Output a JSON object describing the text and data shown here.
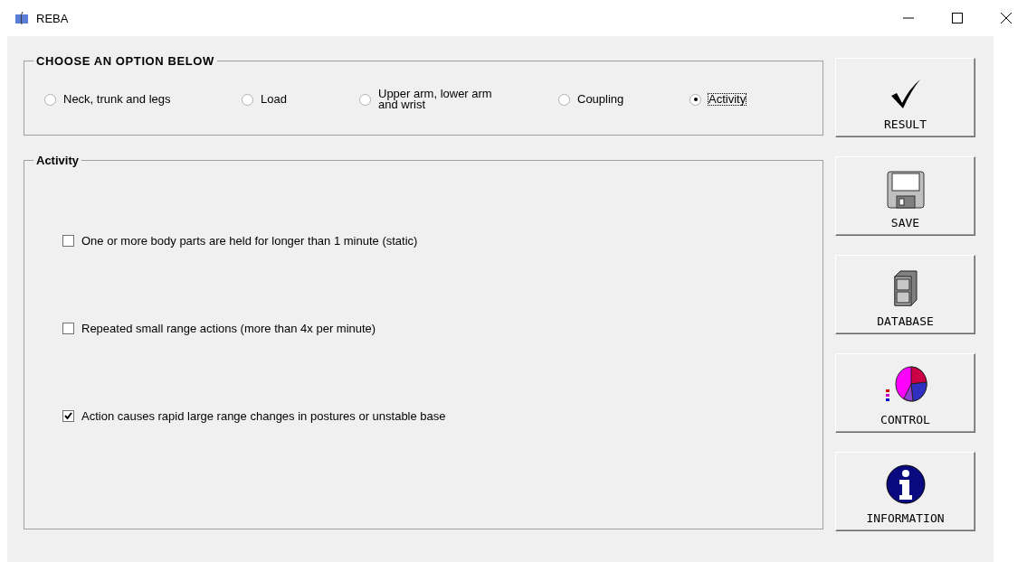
{
  "window": {
    "title": "REBA"
  },
  "options_group": {
    "title": "CHOOSE AN OPTION BELOW",
    "options": [
      {
        "label": "Neck, trunk and legs",
        "selected": false
      },
      {
        "label": "Load",
        "selected": false
      },
      {
        "label": "Upper arm, lower arm\nand wrist",
        "selected": false
      },
      {
        "label": "Coupling",
        "selected": false
      },
      {
        "label": "Activity",
        "selected": true
      }
    ]
  },
  "activity_group": {
    "title": "Activity",
    "items": [
      {
        "label": "One or more body parts are held for longer than 1 minute (static)",
        "checked": false
      },
      {
        "label": "Repeated small range actions (more than 4x per minute)",
        "checked": false
      },
      {
        "label": "Action causes rapid large range changes in postures or unstable base",
        "checked": true
      }
    ]
  },
  "buttons": [
    {
      "label": "RESULT",
      "kind": "check"
    },
    {
      "label": "SAVE",
      "kind": "disk"
    },
    {
      "label": "DATABASE",
      "kind": "cabinet"
    },
    {
      "label": "CONTROL",
      "kind": "chart"
    },
    {
      "label": "INFORMATION",
      "kind": "info"
    }
  ]
}
